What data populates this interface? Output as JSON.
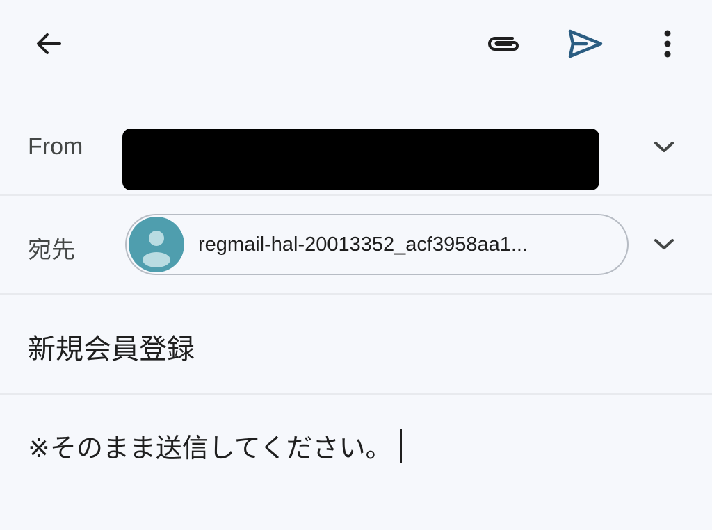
{
  "toolbar": {
    "back_icon": "arrow-left-icon",
    "attach_icon": "paperclip-icon",
    "send_icon": "send-icon",
    "more_icon": "more-vert-icon"
  },
  "from": {
    "label": "From",
    "chevron_icon": "chevron-down-icon"
  },
  "to": {
    "label": "宛先",
    "recipient": "regmail-hal-20013352_acf3958aa1...",
    "avatar_icon": "person-avatar-icon",
    "chevron_icon": "chevron-down-icon"
  },
  "subject": {
    "value": "新規会員登録"
  },
  "body": {
    "value": "※そのまま送信してください。"
  },
  "colors": {
    "background": "#f6f8fc",
    "send_accent": "#2b5d82",
    "avatar": "#4f9eae",
    "divider": "#e8eaee",
    "chip_border": "#b7bcc4"
  }
}
